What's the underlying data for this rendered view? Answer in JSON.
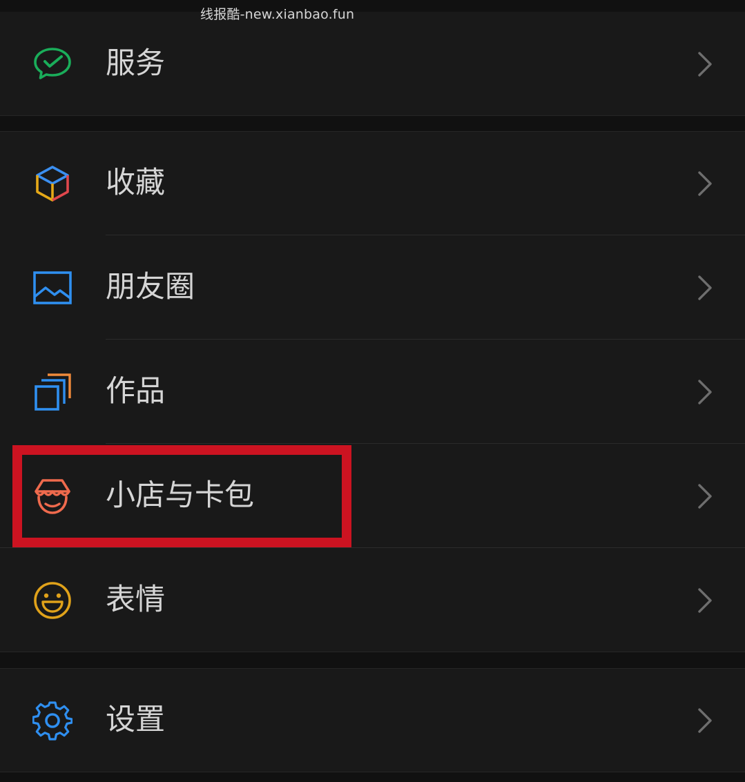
{
  "watermark": "线报酷-new.xianbao.fun",
  "groups": [
    {
      "items": [
        {
          "key": "services",
          "label": "服务",
          "icon": "wechat-pay-icon",
          "color": "#1aad5a"
        }
      ]
    },
    {
      "items": [
        {
          "key": "favorites",
          "label": "收藏",
          "icon": "cube-icon",
          "color": "#3b8ff0"
        },
        {
          "key": "moments",
          "label": "朋友圈",
          "icon": "image-icon",
          "color": "#2f8ff0"
        },
        {
          "key": "works",
          "label": "作品",
          "icon": "stacked-cards-icon",
          "color": "#2f8ff0"
        },
        {
          "key": "shop-cards",
          "label": "小店与卡包",
          "icon": "shop-awning-icon",
          "color": "#ef6a4d",
          "highlighted": true
        },
        {
          "key": "stickers",
          "label": "表情",
          "icon": "smiley-icon",
          "color": "#e0a21a"
        }
      ]
    },
    {
      "items": [
        {
          "key": "settings",
          "label": "设置",
          "icon": "gear-icon",
          "color": "#2f8ff0"
        }
      ]
    }
  ],
  "highlight_color": "#cc1321"
}
